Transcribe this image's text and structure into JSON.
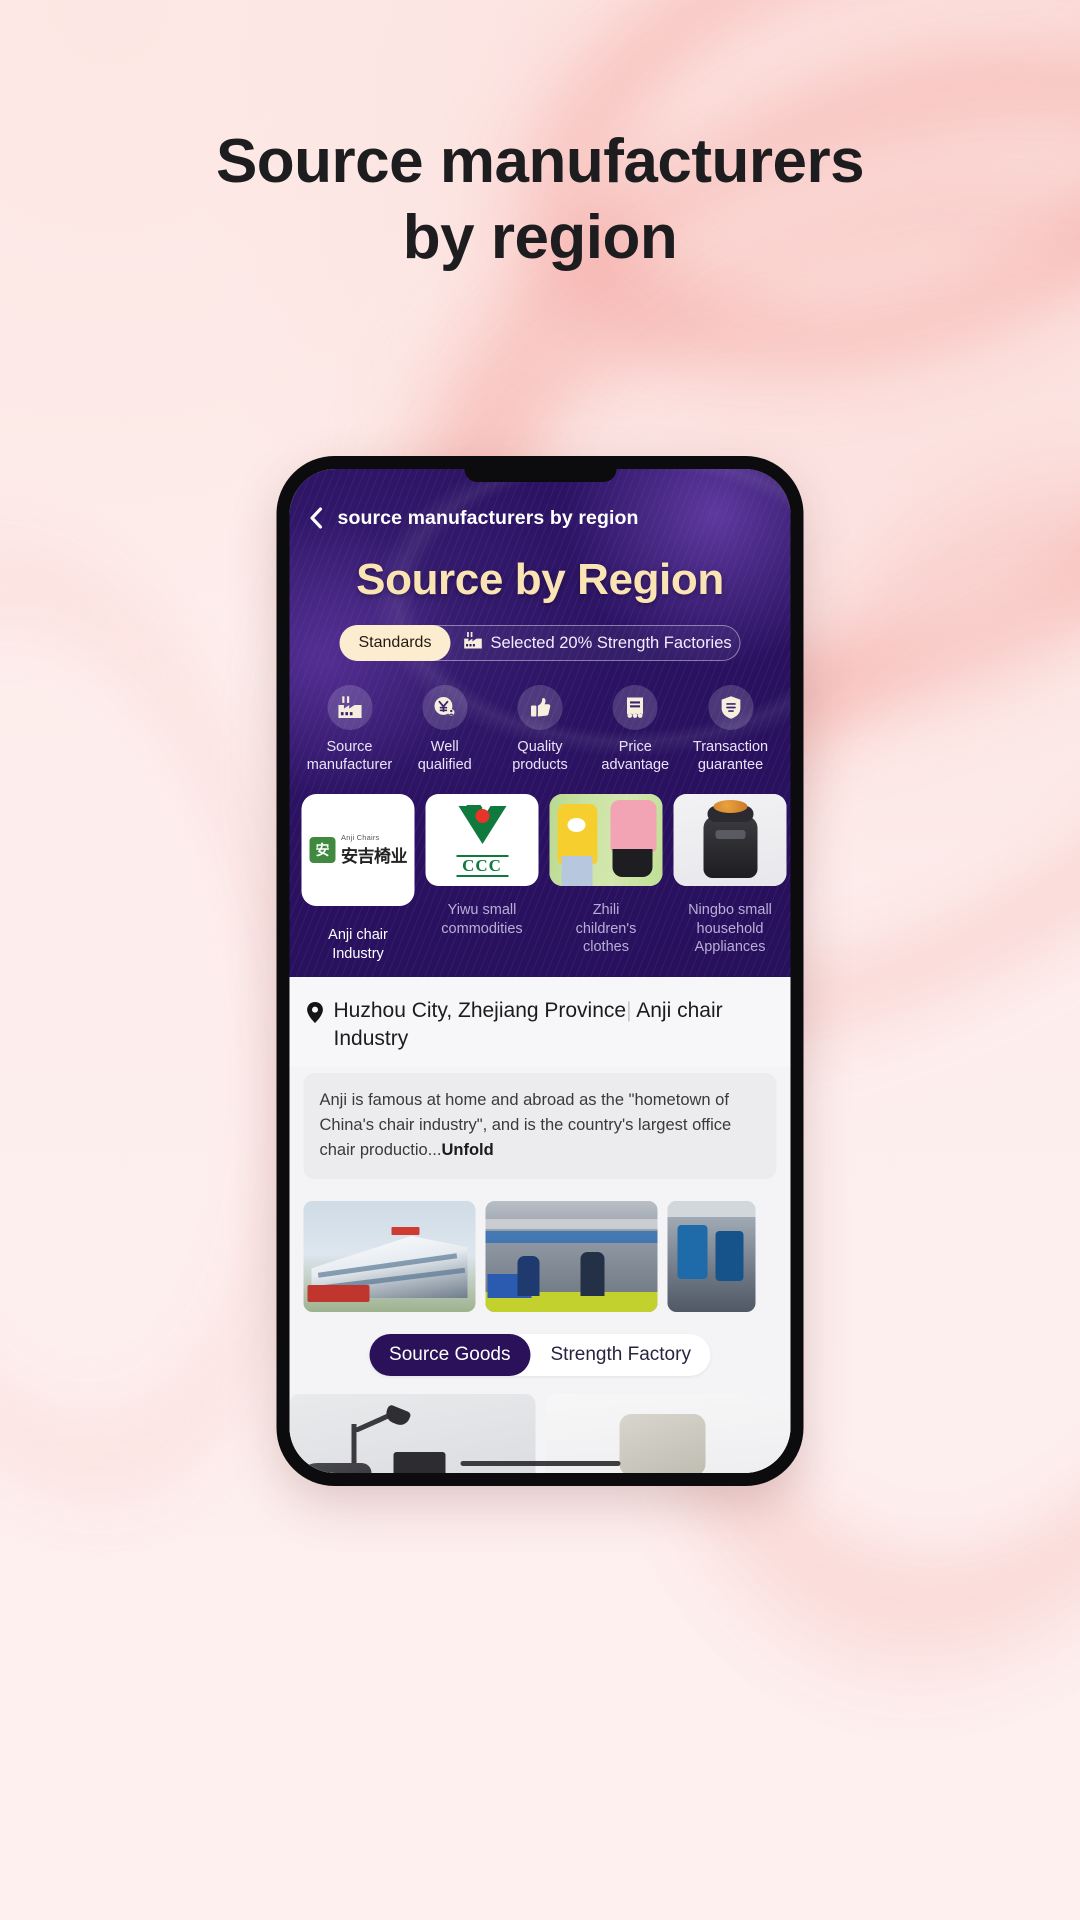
{
  "page": {
    "headline_line1": "Source manufacturers",
    "headline_line2": "by region"
  },
  "app": {
    "nav": {
      "back_icon": "chevron-left-icon",
      "title": "source manufacturers by region"
    },
    "hero": {
      "title": "Source by Region",
      "standards_pill": "Standards",
      "standards_icon": "factory-icon",
      "standards_text": "Selected 20% Strength Factories"
    },
    "features": [
      {
        "icon": "factory-icon",
        "label": "Source\nmanufacturer"
      },
      {
        "icon": "yuan-badge-icon",
        "label": "Well\nqualified"
      },
      {
        "icon": "thumbs-up-icon",
        "label": "Quality\nproducts"
      },
      {
        "icon": "price-tag-icon",
        "label": "Price\nadvantage"
      },
      {
        "icon": "shield-check-icon",
        "label": "Transaction\nguarantee"
      }
    ],
    "brands": [
      {
        "name": "Anji chair\nIndustry",
        "active": true,
        "art": "anji-chairs-logo",
        "logo_en": "Anji Chairs",
        "logo_cn": "安吉椅业",
        "logo_mark": "安"
      },
      {
        "name": "Yiwu small\ncommodities",
        "active": false,
        "art": "ccc-certification-logo",
        "ccc_label": "CCC"
      },
      {
        "name": "Zhili\nchildren's\nclothes",
        "active": false,
        "art": "kids-clothing-photo"
      },
      {
        "name": "Ningbo small\nhousehold\nAppliances",
        "active": false,
        "art": "air-fryer-photo"
      }
    ],
    "detail": {
      "pin_icon": "location-pin-icon",
      "location": "Huzhou City, Zhejiang Province",
      "separator": "|",
      "industry": "Anji chair Industry",
      "description": "Anji is famous at home and abroad as the \"hometown of China's chair industry\", and is the country's largest office chair productio...",
      "unfold_label": "Unfold"
    },
    "gallery": [
      {
        "name": "factory-exterior-photo"
      },
      {
        "name": "assembly-line-photo"
      },
      {
        "name": "machinery-photo"
      }
    ],
    "tabs": [
      {
        "label": "Source Goods",
        "active": true
      },
      {
        "label": "Strength Factory",
        "active": false
      }
    ],
    "products": [
      {
        "name": "office-desk-chair-photo"
      },
      {
        "name": "white-office-chair-photo"
      }
    ]
  },
  "colors": {
    "page_bg": "#fdeeed",
    "hero_purple": "#2b1262",
    "hero_gold": "#fbe4b4",
    "pill_cream": "#fdedd0",
    "tab_active": "#2a1159",
    "headline": "#1d1d1f"
  }
}
